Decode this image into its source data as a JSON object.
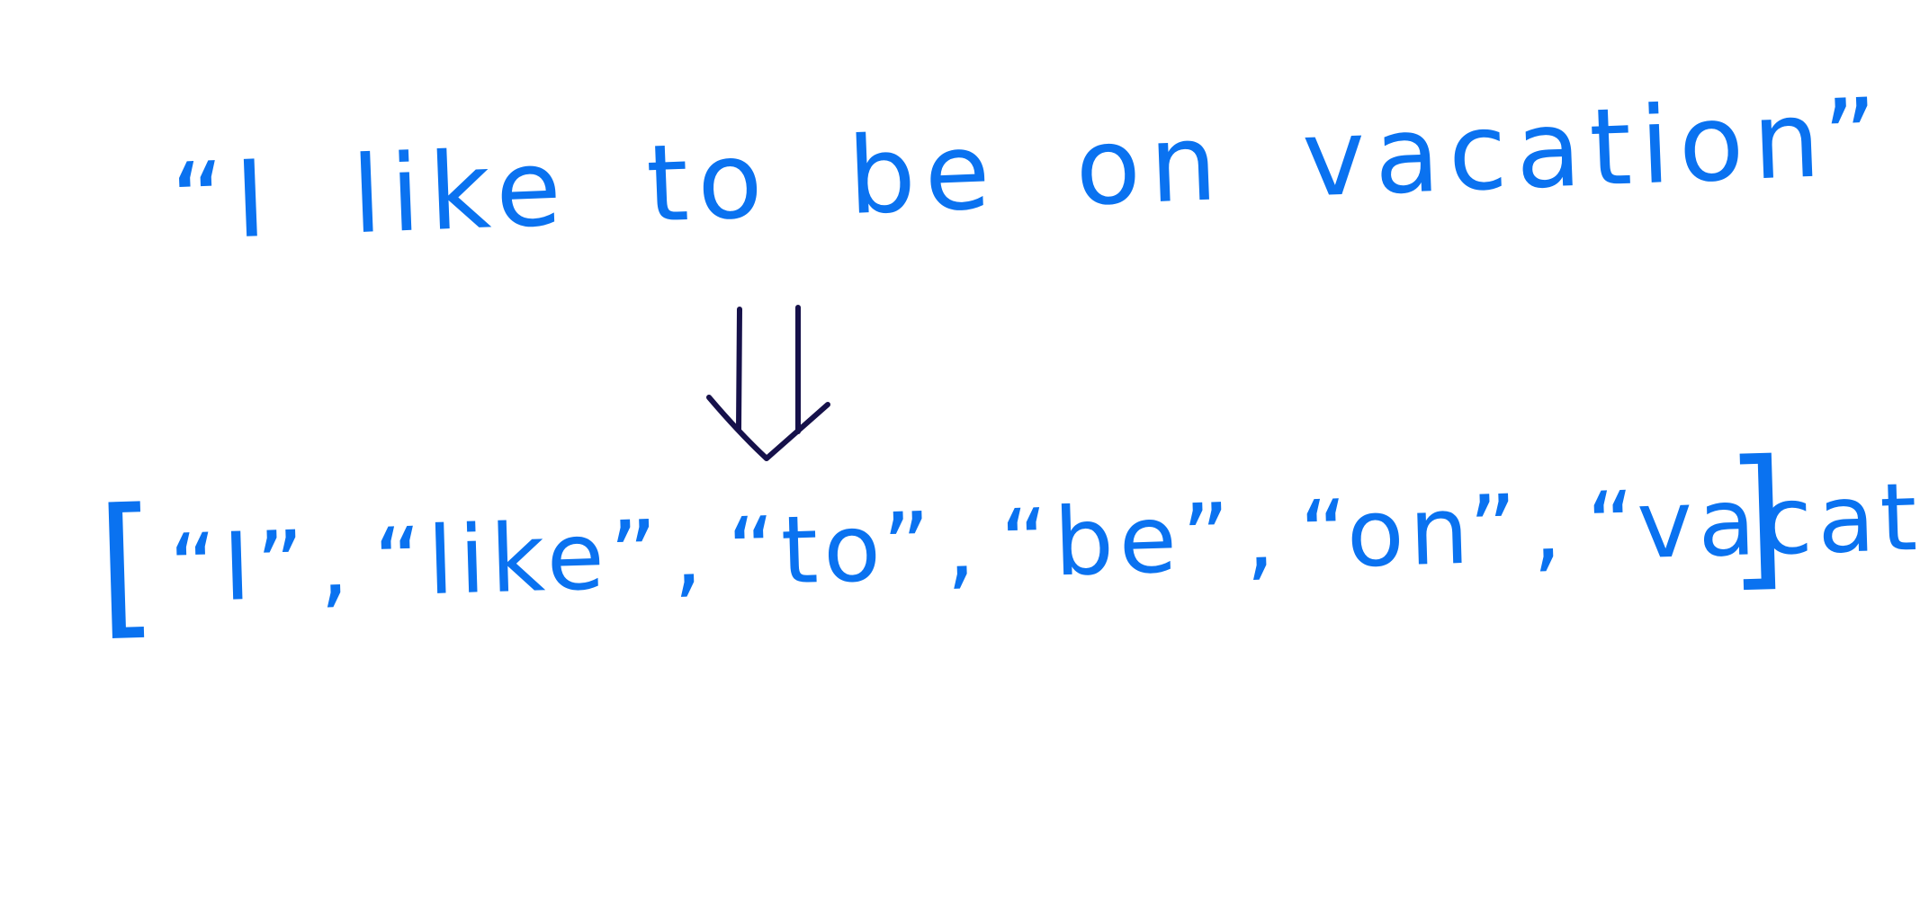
{
  "sentence": "“I like to be on vacation”",
  "tokens": {
    "open_bracket": "[",
    "close_bracket": "]",
    "separator": ",",
    "items": [
      "“I”",
      "“like”",
      "“to”",
      "“be”",
      "“on”",
      "“vacation”"
    ]
  },
  "colors": {
    "ink_blue": "#0a72f0",
    "arrow_navy": "#16114a",
    "background": "#ffffff"
  },
  "icons": {
    "arrow": "double-down-arrow-icon"
  }
}
